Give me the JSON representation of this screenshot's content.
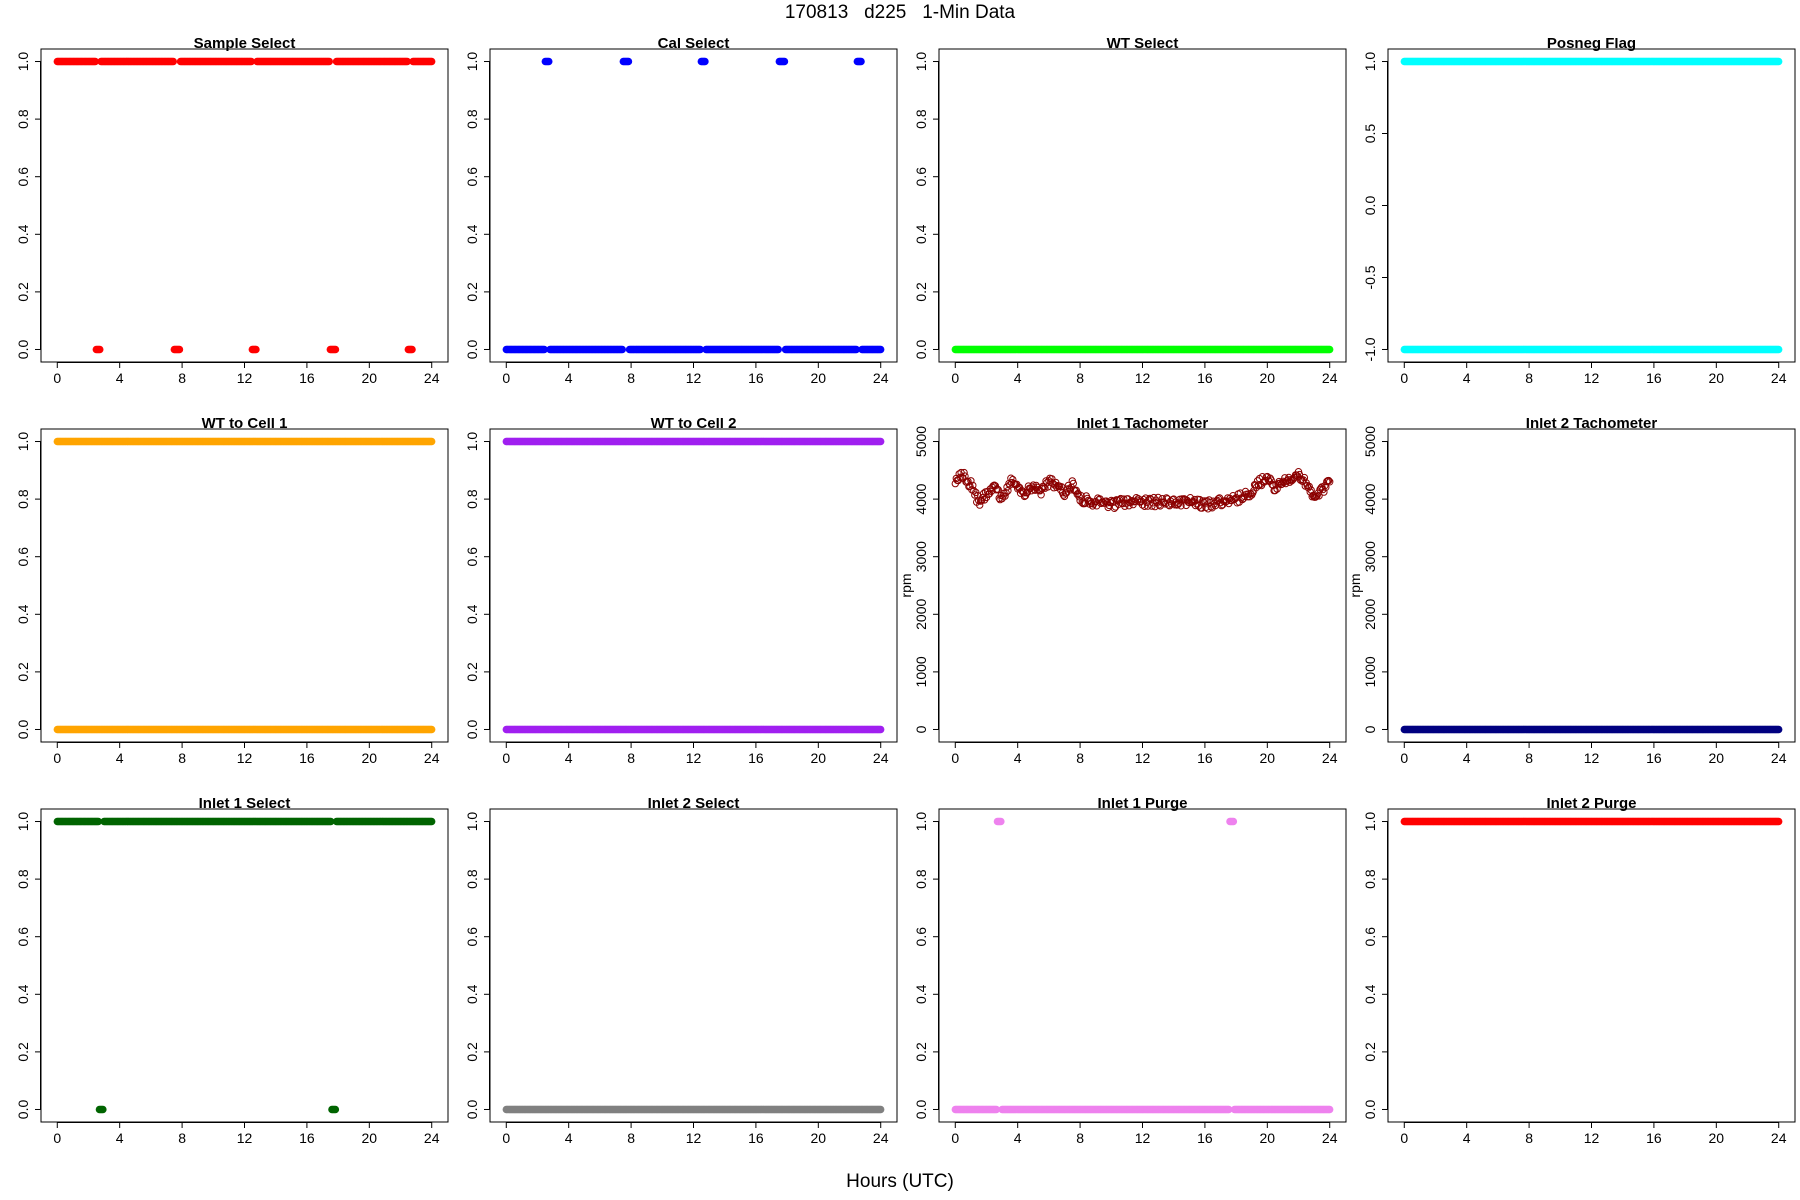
{
  "title": "170813   d225   1-Min Data",
  "xlabel": "Hours (UTC)",
  "chart_data": [
    {
      "type": "scatter",
      "title": "Sample Select",
      "ylabel": "",
      "color": "#ff0000",
      "xlim": [
        0,
        24
      ],
      "ylim": [
        0,
        1
      ],
      "x_ticks": [
        "0",
        "4",
        "8",
        "12",
        "16",
        "20",
        "24"
      ],
      "y_ticks": [
        "0.0",
        "0.2",
        "0.4",
        "0.6",
        "0.8",
        "1.0"
      ],
      "series": [
        {
          "points": [
            [
              0,
              1
            ],
            [
              2.5,
              1
            ],
            [
              2.5,
              0
            ],
            [
              2.8,
              0
            ],
            [
              2.8,
              1
            ],
            [
              7.5,
              1
            ],
            [
              7.5,
              0
            ],
            [
              7.9,
              0
            ],
            [
              7.9,
              1
            ],
            [
              12.5,
              1
            ],
            [
              12.5,
              0
            ],
            [
              12.8,
              0
            ],
            [
              12.8,
              1
            ],
            [
              17.5,
              1
            ],
            [
              17.5,
              0
            ],
            [
              17.9,
              0
            ],
            [
              17.9,
              1
            ],
            [
              22.5,
              1
            ],
            [
              22.5,
              0
            ],
            [
              22.8,
              0
            ],
            [
              22.8,
              1
            ],
            [
              24,
              1
            ]
          ]
        }
      ]
    },
    {
      "type": "scatter",
      "title": "Cal Select",
      "ylabel": "",
      "color": "#0000ff",
      "xlim": [
        0,
        24
      ],
      "ylim": [
        0,
        1
      ],
      "x_ticks": [
        "0",
        "4",
        "8",
        "12",
        "16",
        "20",
        "24"
      ],
      "y_ticks": [
        "0.0",
        "0.2",
        "0.4",
        "0.6",
        "0.8",
        "1.0"
      ],
      "series": [
        {
          "points": [
            [
              0,
              0
            ],
            [
              2.5,
              0
            ],
            [
              2.5,
              1
            ],
            [
              2.8,
              1
            ],
            [
              2.8,
              0
            ],
            [
              7.5,
              0
            ],
            [
              7.5,
              1
            ],
            [
              7.9,
              1
            ],
            [
              7.9,
              0
            ],
            [
              12.5,
              0
            ],
            [
              12.5,
              1
            ],
            [
              12.8,
              1
            ],
            [
              12.8,
              0
            ],
            [
              17.5,
              0
            ],
            [
              17.5,
              1
            ],
            [
              17.9,
              1
            ],
            [
              17.9,
              0
            ],
            [
              22.5,
              0
            ],
            [
              22.5,
              1
            ],
            [
              22.8,
              1
            ],
            [
              22.8,
              0
            ],
            [
              24,
              0
            ]
          ]
        }
      ]
    },
    {
      "type": "scatter",
      "title": "WT Select",
      "ylabel": "",
      "color": "#00ff00",
      "xlim": [
        0,
        24
      ],
      "ylim": [
        0,
        1
      ],
      "x_ticks": [
        "0",
        "4",
        "8",
        "12",
        "16",
        "20",
        "24"
      ],
      "y_ticks": [
        "0.0",
        "0.2",
        "0.4",
        "0.6",
        "0.8",
        "1.0"
      ],
      "series": [
        {
          "points": [
            [
              0,
              0
            ],
            [
              24,
              0
            ]
          ]
        }
      ]
    },
    {
      "type": "scatter",
      "title": "Posneg Flag",
      "ylabel": "",
      "color": "#00ffff",
      "xlim": [
        0,
        24
      ],
      "ylim": [
        -1,
        1
      ],
      "x_ticks": [
        "0",
        "4",
        "8",
        "12",
        "16",
        "20",
        "24"
      ],
      "y_ticks": [
        "-1.0",
        "-0.5",
        "0.0",
        "0.5",
        "1.0"
      ],
      "series": [
        {
          "points": [
            [
              0,
              1
            ],
            [
              24,
              1
            ]
          ]
        },
        {
          "points": [
            [
              0,
              -1
            ],
            [
              24,
              -1
            ]
          ]
        }
      ]
    },
    {
      "type": "scatter",
      "title": "WT to Cell 1",
      "ylabel": "",
      "color": "#ffa500",
      "xlim": [
        0,
        24
      ],
      "ylim": [
        0,
        1
      ],
      "x_ticks": [
        "0",
        "4",
        "8",
        "12",
        "16",
        "20",
        "24"
      ],
      "y_ticks": [
        "0.0",
        "0.2",
        "0.4",
        "0.6",
        "0.8",
        "1.0"
      ],
      "series": [
        {
          "points": [
            [
              0,
              1
            ],
            [
              24,
              1
            ]
          ]
        },
        {
          "points": [
            [
              0,
              0
            ],
            [
              24,
              0
            ]
          ]
        }
      ]
    },
    {
      "type": "scatter",
      "title": "WT to Cell 2",
      "ylabel": "",
      "color": "#a020f0",
      "xlim": [
        0,
        24
      ],
      "ylim": [
        0,
        1
      ],
      "x_ticks": [
        "0",
        "4",
        "8",
        "12",
        "16",
        "20",
        "24"
      ],
      "y_ticks": [
        "0.0",
        "0.2",
        "0.4",
        "0.6",
        "0.8",
        "1.0"
      ],
      "series": [
        {
          "points": [
            [
              0,
              1
            ],
            [
              24,
              1
            ]
          ]
        },
        {
          "points": [
            [
              0,
              0
            ],
            [
              24,
              0
            ]
          ]
        }
      ]
    },
    {
      "type": "scatter",
      "title": "Inlet 1 Tachometer",
      "ylabel": "rpm",
      "color": "#8b0000",
      "hollow": true,
      "xlim": [
        0,
        24
      ],
      "ylim": [
        0,
        5000
      ],
      "x_ticks": [
        "0",
        "4",
        "8",
        "12",
        "16",
        "20",
        "24"
      ],
      "y_ticks": [
        "0",
        "1000",
        "2000",
        "3000",
        "4000",
        "5000"
      ],
      "series": [
        {
          "points": [
            [
              0,
              4350
            ],
            [
              0.5,
              4400
            ],
            [
              1,
              4250
            ],
            [
              1.5,
              3950
            ],
            [
              2,
              4100
            ],
            [
              2.5,
              4250
            ],
            [
              3,
              4000
            ],
            [
              3.5,
              4300
            ],
            [
              4,
              4200
            ],
            [
              4.5,
              4100
            ],
            [
              5,
              4250
            ],
            [
              5.5,
              4150
            ],
            [
              6,
              4300
            ],
            [
              6.5,
              4250
            ],
            [
              7,
              4100
            ],
            [
              7.5,
              4250
            ],
            [
              8,
              4000
            ],
            [
              9,
              3950
            ],
            [
              10,
              3900
            ],
            [
              11,
              3950
            ],
            [
              12,
              3950
            ],
            [
              13,
              3950
            ],
            [
              14,
              3950
            ],
            [
              15,
              3950
            ],
            [
              16,
              3900
            ],
            [
              17,
              3950
            ],
            [
              18,
              4000
            ],
            [
              19,
              4100
            ],
            [
              19.5,
              4300
            ],
            [
              20,
              4350
            ],
            [
              20.5,
              4200
            ],
            [
              21,
              4300
            ],
            [
              21.5,
              4350
            ],
            [
              22,
              4450
            ],
            [
              22.5,
              4250
            ],
            [
              23,
              4050
            ],
            [
              23.5,
              4150
            ],
            [
              24,
              4300
            ]
          ]
        }
      ]
    },
    {
      "type": "scatter",
      "title": "Inlet 2 Tachometer",
      "ylabel": "rpm",
      "color": "#000080",
      "xlim": [
        0,
        24
      ],
      "ylim": [
        0,
        5000
      ],
      "x_ticks": [
        "0",
        "4",
        "8",
        "12",
        "16",
        "20",
        "24"
      ],
      "y_ticks": [
        "0",
        "1000",
        "2000",
        "3000",
        "4000",
        "5000"
      ],
      "series": [
        {
          "points": [
            [
              0,
              0
            ],
            [
              24,
              0
            ]
          ]
        }
      ]
    },
    {
      "type": "scatter",
      "title": "Inlet 1 Select",
      "ylabel": "",
      "color": "#006400",
      "xlim": [
        0,
        24
      ],
      "ylim": [
        0,
        1
      ],
      "x_ticks": [
        "0",
        "4",
        "8",
        "12",
        "16",
        "20",
        "24"
      ],
      "y_ticks": [
        "0.0",
        "0.2",
        "0.4",
        "0.6",
        "0.8",
        "1.0"
      ],
      "series": [
        {
          "points": [
            [
              0,
              1
            ],
            [
              2.7,
              1
            ],
            [
              2.7,
              0
            ],
            [
              3.0,
              0
            ],
            [
              3.0,
              1
            ],
            [
              17.6,
              1
            ],
            [
              17.6,
              0
            ],
            [
              17.9,
              0
            ],
            [
              17.9,
              1
            ],
            [
              24,
              1
            ]
          ]
        }
      ]
    },
    {
      "type": "scatter",
      "title": "Inlet 2 Select",
      "ylabel": "",
      "color": "#808080",
      "xlim": [
        0,
        24
      ],
      "ylim": [
        0,
        1
      ],
      "x_ticks": [
        "0",
        "4",
        "8",
        "12",
        "16",
        "20",
        "24"
      ],
      "y_ticks": [
        "0.0",
        "0.2",
        "0.4",
        "0.6",
        "0.8",
        "1.0"
      ],
      "series": [
        {
          "points": [
            [
              0,
              0
            ],
            [
              24,
              0
            ]
          ]
        }
      ]
    },
    {
      "type": "scatter",
      "title": "Inlet 1 Purge",
      "ylabel": "",
      "color": "#ee82ee",
      "xlim": [
        0,
        24
      ],
      "ylim": [
        0,
        1
      ],
      "x_ticks": [
        "0",
        "4",
        "8",
        "12",
        "16",
        "20",
        "24"
      ],
      "y_ticks": [
        "0.0",
        "0.2",
        "0.4",
        "0.6",
        "0.8",
        "1.0"
      ],
      "series": [
        {
          "points": [
            [
              0,
              0
            ],
            [
              2.7,
              0
            ],
            [
              2.7,
              1
            ],
            [
              3.0,
              1
            ],
            [
              3.0,
              0
            ],
            [
              17.6,
              0
            ],
            [
              17.6,
              1
            ],
            [
              17.9,
              1
            ],
            [
              17.9,
              0
            ],
            [
              24,
              0
            ]
          ]
        }
      ]
    },
    {
      "type": "scatter",
      "title": "Inlet 2 Purge",
      "ylabel": "",
      "color": "#ff0000",
      "xlim": [
        0,
        24
      ],
      "ylim": [
        0,
        1
      ],
      "x_ticks": [
        "0",
        "4",
        "8",
        "12",
        "16",
        "20",
        "24"
      ],
      "y_ticks": [
        "0.0",
        "0.2",
        "0.4",
        "0.6",
        "0.8",
        "1.0"
      ],
      "series": [
        {
          "points": [
            [
              0,
              1
            ],
            [
              24,
              1
            ]
          ]
        }
      ]
    }
  ]
}
